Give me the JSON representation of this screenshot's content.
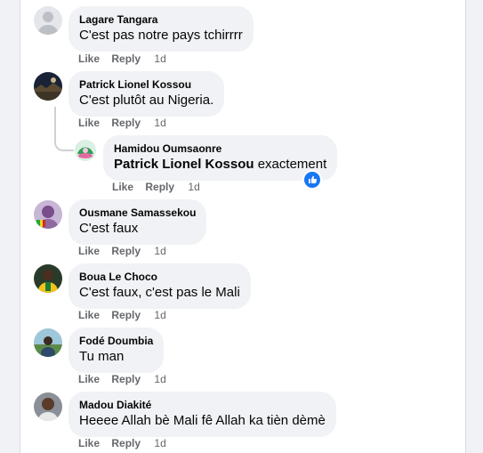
{
  "comments": [
    {
      "author": "Lagare Tangara",
      "text": "C'est pas notre pays tchirrrr",
      "like": "Like",
      "reply": "Reply",
      "time": "1d"
    },
    {
      "author": "Patrick Lionel Kossou",
      "text": "C'est plutôt au Nigeria.",
      "like": "Like",
      "reply": "Reply",
      "time": "1d"
    },
    {
      "author": "Ousmane Samassekou",
      "text": "C'est faux",
      "like": "Like",
      "reply": "Reply",
      "time": "1d"
    },
    {
      "author": "Boua Le Choco",
      "text": "C'est faux, c'est pas le Mali",
      "like": "Like",
      "reply": "Reply",
      "time": "1d"
    },
    {
      "author": "Fodé Doumbia",
      "text": "Tu man",
      "like": "Like",
      "reply": "Reply",
      "time": "1d"
    },
    {
      "author": "Madou Diakité",
      "text": "Heeee Allah bè Mali fê Allah ka tièn dèmè",
      "like": "Like",
      "reply": "Reply",
      "time": "1d"
    }
  ],
  "reply": {
    "author": "Hamidou Oumsaonre",
    "mention": "Patrick Lionel Kossou",
    "text": " exactement",
    "like": "Like",
    "reply": "Reply",
    "time": "1d",
    "reaction_icon": "thumbs-up-icon"
  },
  "colors": {
    "bubble": "#f0f2f5",
    "meta": "#65676b",
    "reaction": "#1877f2"
  }
}
